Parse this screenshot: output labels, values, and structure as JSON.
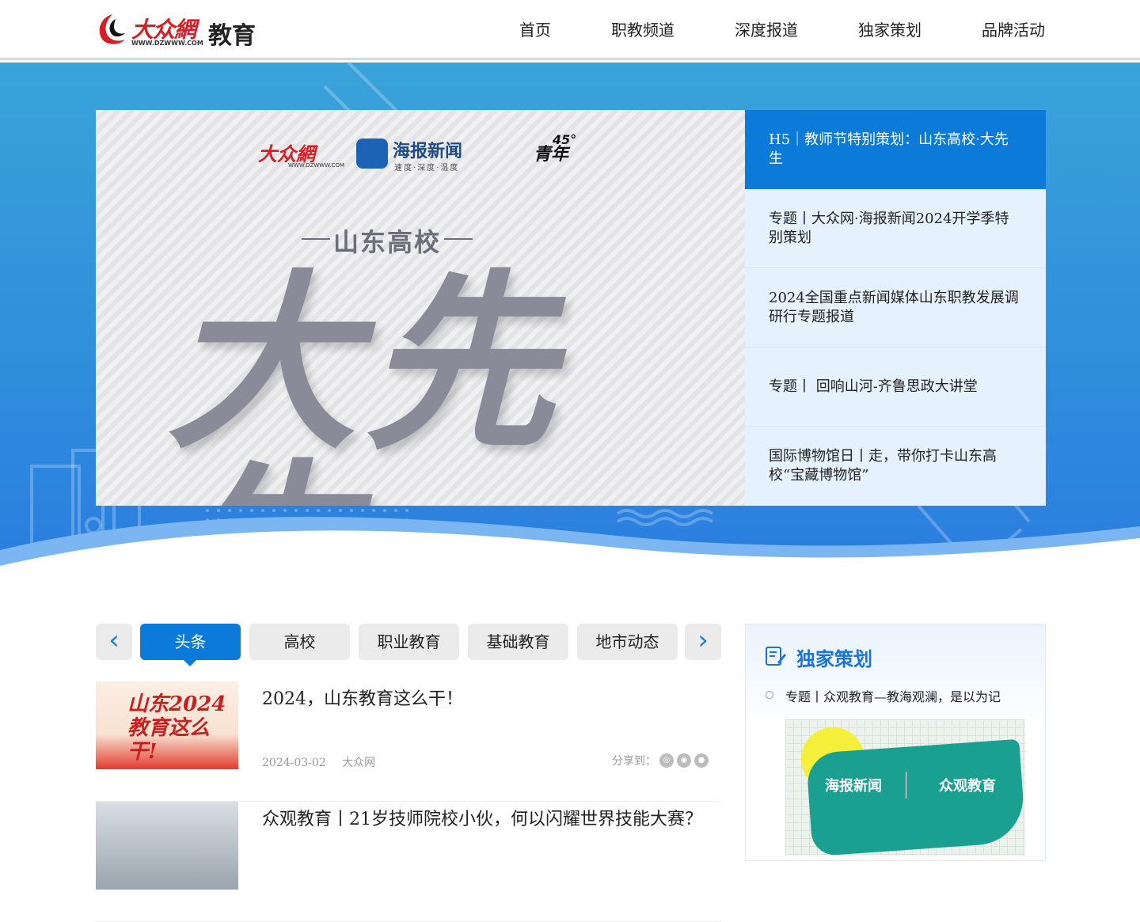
{
  "header": {
    "logo_brand": "大众網",
    "logo_url": "WWW.DZWWW.COM",
    "logo_section": "教育",
    "nav": [
      "首页",
      "职教频道",
      "深度报道",
      "独家策划",
      "品牌活动"
    ]
  },
  "banner": {
    "logo_dz": "大众網",
    "logo_dz_url": "WWW.DZWWW.COM",
    "logo_haibao": "海报新闻",
    "logo_haibao_sub": "速度·深度·温度",
    "logo_qn_num": "45°",
    "logo_qn": "青年",
    "subtitle": "山东高校",
    "main_text": "大先生"
  },
  "side_list": [
    "H5｜教师节特别策划：山东高校·大先生",
    "专题丨大众网·海报新闻2024开学季特别策划",
    "2024全国重点新闻媒体山东职教发展调研行专题报道",
    "专题丨 回响山河-齐鲁思政大讲堂",
    "国际博物馆日丨走，带你打卡山东高校“宝藏博物馆”"
  ],
  "tabs": {
    "prev": "‹",
    "next": "›",
    "items": [
      "头条",
      "高校",
      "职业教育",
      "基础教育",
      "地市动态"
    ]
  },
  "news": [
    {
      "title": "2024，山东教育这么干！",
      "thumb_text": "山东2024教育这么干!",
      "date": "2024-03-02",
      "source": "大众网",
      "share_label": "分享到："
    },
    {
      "title": "众观教育丨21岁技师院校小伙，何以闪耀世界技能大赛？"
    }
  ],
  "panel": {
    "title": "独家策划",
    "item": "专题丨众观教育—教海观澜，是以为记",
    "img_left": "海报新闻",
    "img_right": "众观教育"
  }
}
